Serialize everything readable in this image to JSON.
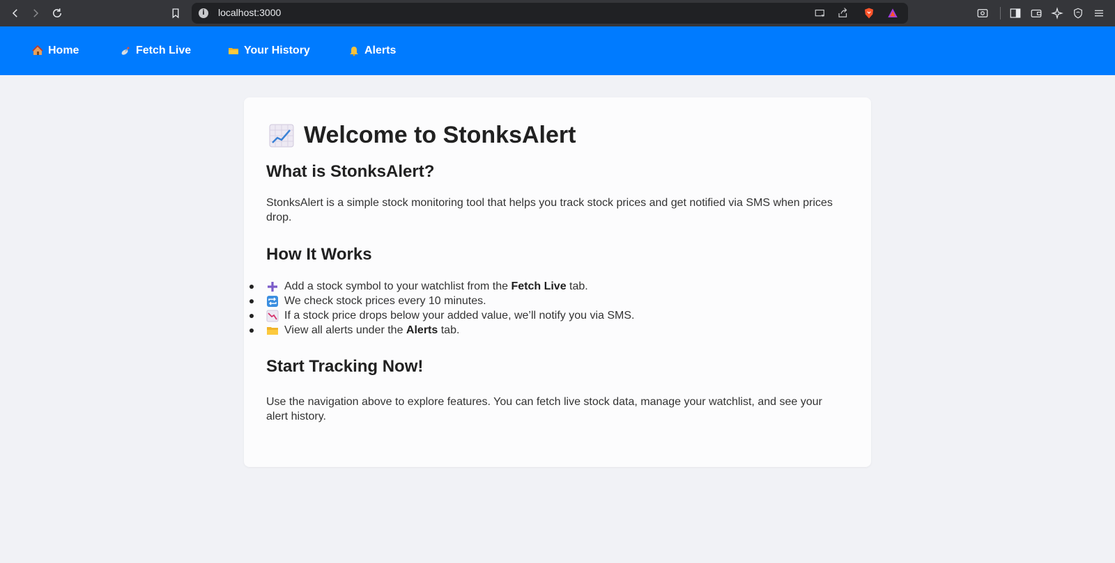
{
  "browser": {
    "url": "localhost:3000"
  },
  "nav": {
    "items": [
      {
        "label": "Home",
        "icon": "house-icon"
      },
      {
        "label": "Fetch Live",
        "icon": "satellite-icon"
      },
      {
        "label": "Your History",
        "icon": "folder-icon"
      },
      {
        "label": "Alerts",
        "icon": "bell-icon"
      }
    ]
  },
  "main": {
    "title": "Welcome to StonksAlert",
    "title_icon": "chart-increasing-icon",
    "sections": {
      "what": {
        "heading": "What is StonksAlert?",
        "text": "StonksAlert is a simple stock monitoring tool that helps you track stock prices and get notified via SMS when prices drop."
      },
      "how": {
        "heading": "How It Works",
        "steps": [
          {
            "icon": "plus-icon",
            "before": "Add a stock symbol to your watchlist from the ",
            "bold": "Fetch Live",
            "after": " tab."
          },
          {
            "icon": "repeat-icon",
            "before": "We check stock prices every 10 minutes.",
            "bold": "",
            "after": ""
          },
          {
            "icon": "chart-decreasing-icon",
            "before": "If a stock price drops below your added value, we’ll notify you via SMS.",
            "bold": "",
            "after": ""
          },
          {
            "icon": "folder-icon",
            "before": "View all alerts under the ",
            "bold": "Alerts",
            "after": " tab."
          }
        ]
      },
      "start": {
        "heading": "Start Tracking Now!",
        "text": "Use the navigation above to explore features. You can fetch live stock data, manage your watchlist, and see your alert history."
      }
    }
  },
  "colors": {
    "nav_bg": "#007bff",
    "page_bg": "#f1f2f6",
    "card_bg": "#fcfcfd"
  }
}
